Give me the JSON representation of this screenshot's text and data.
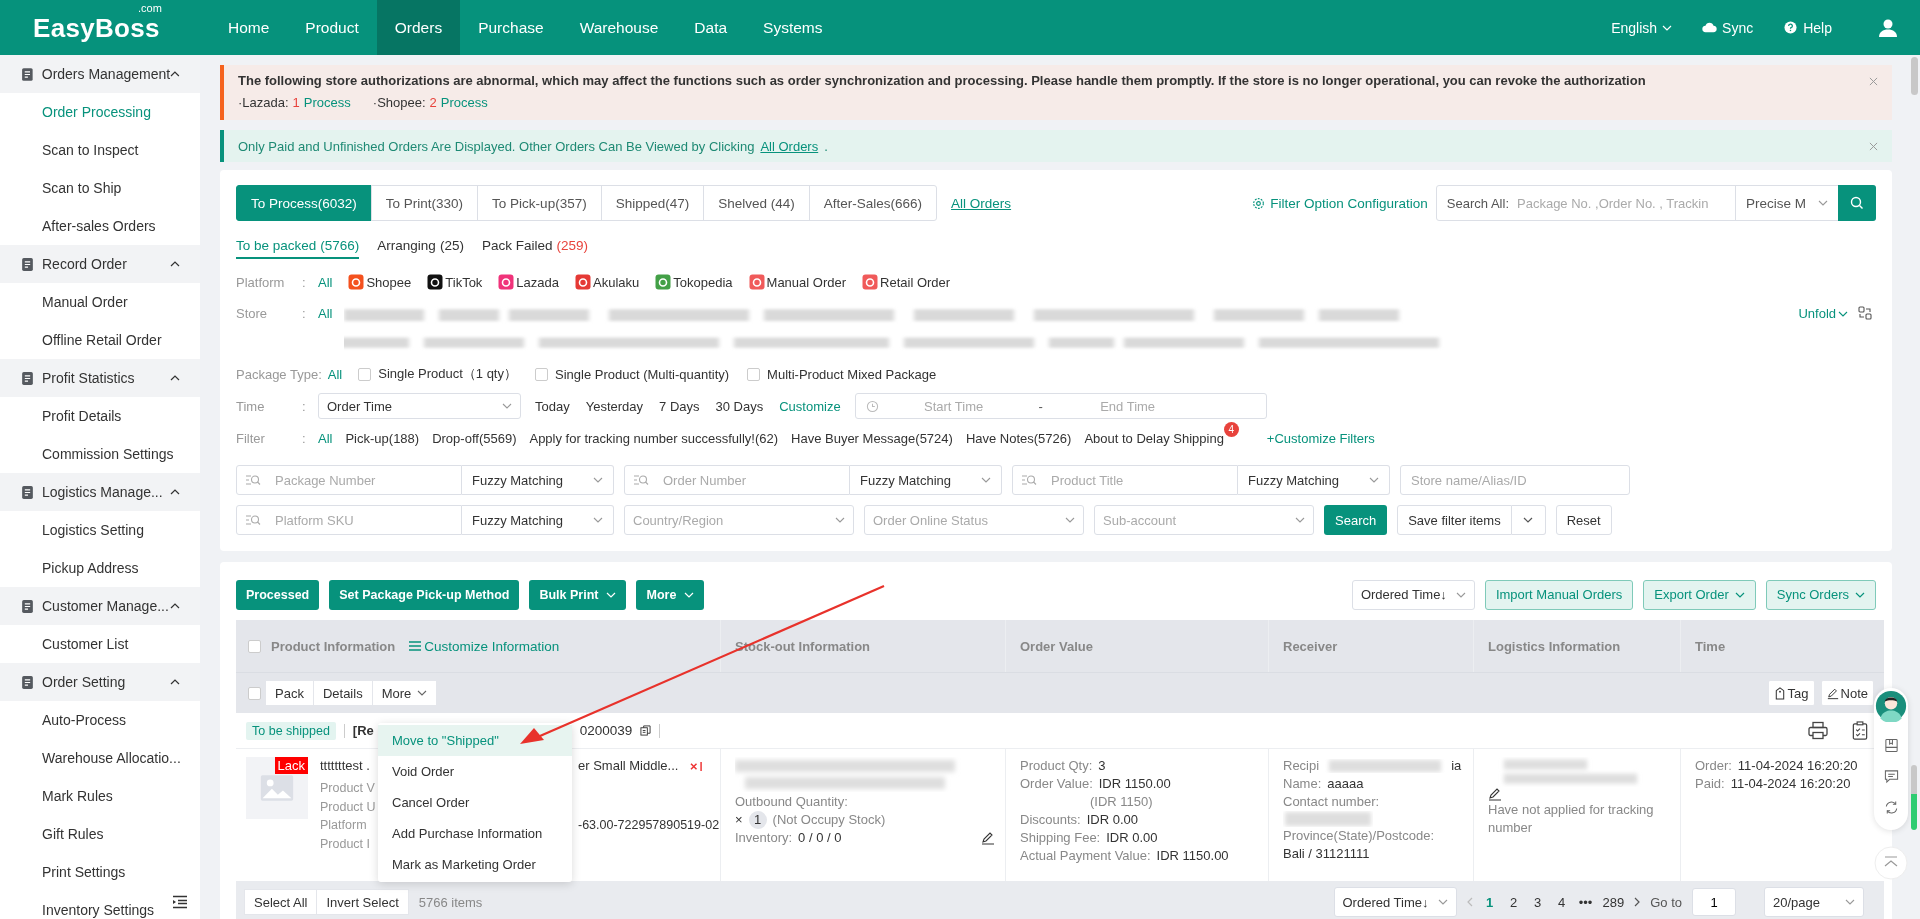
{
  "header": {
    "logo": "EasyBoss",
    "logo_suffix": ".com",
    "nav": [
      {
        "label": "Home",
        "selected": false
      },
      {
        "label": "Product",
        "selected": false
      },
      {
        "label": "Orders",
        "selected": true
      },
      {
        "label": "Purchase",
        "selected": false
      },
      {
        "label": "Warehouse",
        "selected": false
      },
      {
        "label": "Data",
        "selected": false
      },
      {
        "label": "Systems",
        "selected": false
      }
    ],
    "language": "English",
    "sync": "Sync",
    "help": "Help"
  },
  "sidebar": [
    {
      "title": "Orders Management",
      "expanded": true,
      "items": [
        {
          "label": "Order Processing",
          "selected": true
        },
        {
          "label": "Scan to Inspect",
          "selected": false
        },
        {
          "label": "Scan to Ship",
          "selected": false
        },
        {
          "label": "After-sales Orders",
          "selected": false
        }
      ]
    },
    {
      "title": "Record Order",
      "expanded": true,
      "items": [
        {
          "label": "Manual Order",
          "selected": false
        },
        {
          "label": "Offline Retail Order",
          "selected": false
        }
      ]
    },
    {
      "title": "Profit Statistics",
      "expanded": true,
      "items": [
        {
          "label": "Profit Details",
          "selected": false
        },
        {
          "label": "Commission Settings",
          "selected": false
        }
      ]
    },
    {
      "title": "Logistics Manage...",
      "expanded": true,
      "items": [
        {
          "label": "Logistics Setting",
          "selected": false
        },
        {
          "label": "Pickup Address",
          "selected": false
        }
      ]
    },
    {
      "title": "Customer Manage...",
      "expanded": true,
      "items": [
        {
          "label": "Customer List",
          "selected": false
        }
      ]
    },
    {
      "title": "Order Setting",
      "expanded": true,
      "items": [
        {
          "label": "Auto-Process",
          "selected": false
        },
        {
          "label": "Warehouse Allocatio...",
          "selected": false
        },
        {
          "label": "Mark Rules",
          "selected": false
        },
        {
          "label": "Gift Rules",
          "selected": false
        },
        {
          "label": "Print Settings",
          "selected": false
        },
        {
          "label": "Inventory Settings",
          "selected": false
        }
      ]
    }
  ],
  "alerts": {
    "warning": {
      "text": "The following store authorizations are abnormal, which may affect the functions such as order synchronization and processing. Please handle them promptly. If the store is no longer operational, you can revoke the authorization",
      "stores": [
        {
          "platform": "·Lazada:",
          "count": "1",
          "action": "Process"
        },
        {
          "platform": "·Shopee:",
          "count": "2",
          "action": "Process"
        }
      ]
    },
    "info": {
      "text": "Only Paid and Unfinished Orders Are Displayed. Other Orders Can Be Viewed by Clicking",
      "link": "All Orders",
      "end": "."
    }
  },
  "status_tabs": [
    {
      "label": "To Process(6032)",
      "selected": true
    },
    {
      "label": "To Print(330)",
      "selected": false
    },
    {
      "label": "To Pick-up(357)",
      "selected": false
    },
    {
      "label": "Shipped(47)",
      "selected": false
    },
    {
      "label": "Shelved (44)",
      "selected": false
    },
    {
      "label": "After-Sales(666)",
      "selected": false
    }
  ],
  "all_orders_link": "All Orders",
  "filter_config": "Filter Option Configuration",
  "search": {
    "label": "Search All:",
    "placeholder": "Package No. ,Order No. , Trackin",
    "mode": "Precise M"
  },
  "sub_tabs": [
    {
      "label": "To be packed",
      "count": "(5766)",
      "selected": true,
      "warning": false
    },
    {
      "label": "Arranging",
      "count": "(25)",
      "selected": false,
      "warning": false
    },
    {
      "label": "Pack Failed",
      "count": "(259)",
      "selected": false,
      "warning": true
    }
  ],
  "filters": {
    "platform": {
      "label": "Platform",
      "sep": ":",
      "options": [
        {
          "label": "All",
          "selected": true
        },
        {
          "label": "Shopee",
          "selected": false
        },
        {
          "label": "TikTok",
          "selected": false
        },
        {
          "label": "Lazada",
          "selected": false
        },
        {
          "label": "Akulaku",
          "selected": false
        },
        {
          "label": "Tokopedia",
          "selected": false
        },
        {
          "label": "Manual Order",
          "selected": false
        },
        {
          "label": "Retail Order",
          "selected": false
        }
      ]
    },
    "store": {
      "label": "Store",
      "sep": ":",
      "all": "All",
      "unfold": "Unfold"
    },
    "package_type": {
      "label": "Package Type",
      "sep": ":",
      "all": "All",
      "options": [
        {
          "label": "Single Product（1 qty）",
          "checked": false
        },
        {
          "label": "Single Product (Multi-quantity)",
          "checked": false
        },
        {
          "label": "Multi-Product Mixed Package",
          "checked": false
        }
      ]
    },
    "time": {
      "label": "Time",
      "sep": ":",
      "field": "Order Time",
      "presets": [
        "Today",
        "Yesterday",
        "7 Days",
        "30 Days"
      ],
      "customize": "Customize",
      "start_placeholder": "Start Time",
      "to": "-",
      "end_placeholder": "End Time"
    },
    "filter": {
      "label": "Filter",
      "sep": ":",
      "options": [
        {
          "label": "All",
          "selected": true
        },
        {
          "label": "Pick-up(188)",
          "selected": false
        },
        {
          "label": "Drop-off(5569)",
          "selected": false
        },
        {
          "label": "Apply for tracking number successfully!(62)",
          "selected": false
        },
        {
          "label": "Have Buyer Message(5724)",
          "selected": false
        },
        {
          "label": "Have Notes(5726)",
          "selected": false
        },
        {
          "label": "About to Delay Shipping",
          "selected": false,
          "badge": "4"
        }
      ],
      "customize": "+Customize Filters"
    }
  },
  "search_fields": [
    {
      "kind": "text",
      "placeholder": "Package Number",
      "match": "Fuzzy Matching"
    },
    {
      "kind": "text",
      "placeholder": "Order Number",
      "match": "Fuzzy Matching"
    },
    {
      "kind": "text",
      "placeholder": "Product Title",
      "match": "Fuzzy Matching"
    },
    {
      "kind": "plain",
      "placeholder": "Store name/Alias/ID"
    },
    {
      "kind": "text",
      "placeholder": "Platform SKU",
      "match": "Fuzzy Matching"
    },
    {
      "kind": "select",
      "placeholder": "Country/Region"
    },
    {
      "kind": "select",
      "placeholder": "Order Online Status"
    },
    {
      "kind": "select",
      "placeholder": "Sub-account"
    }
  ],
  "search_actions": {
    "search": "Search",
    "save": "Save filter items",
    "reset": "Reset"
  },
  "toolbar": {
    "actions": [
      {
        "label": "Processed",
        "menu": false
      },
      {
        "label": "Set Package Pick-up Method",
        "menu": false
      },
      {
        "label": "Bulk Print",
        "menu": true
      },
      {
        "label": "More",
        "menu": true
      }
    ],
    "sort": "Ordered Time↓",
    "right": [
      {
        "label": "Import Manual Orders",
        "menu": false
      },
      {
        "label": "Export Order",
        "menu": true
      },
      {
        "label": "Sync Orders",
        "menu": true
      }
    ]
  },
  "table": {
    "select_all_checked": false,
    "columns": [
      "Product Information",
      "Stock-out Information",
      "Order Value",
      "Receiver",
      "Logistics Information",
      "Time"
    ],
    "customize": "Customize Information",
    "package": {
      "checked": false,
      "actions": [
        {
          "label": "Pack",
          "menu": false
        },
        {
          "label": "Details",
          "menu": false
        },
        {
          "label": "More",
          "menu": true
        }
      ],
      "tag": "Tag",
      "note": "Note",
      "status": "To be shipped",
      "number_start": "[Re",
      "number_end": "0200039",
      "menu": [
        {
          "label": "Move to \"Shipped\"",
          "selected": true
        },
        {
          "label": "Void Order",
          "selected": false
        },
        {
          "label": "Cancel Order",
          "selected": false
        },
        {
          "label": "Add Purchase Information",
          "selected": false
        },
        {
          "label": "Mark as Marketing Order",
          "selected": false
        }
      ],
      "product": {
        "badge": "Lack",
        "name_start": "tttttttest .",
        "name_end": "er Small Middle...",
        "fields": [
          "Product V",
          "Product U",
          "Platform",
          "Product I"
        ],
        "sku_end": "-63.00-722957890519-02"
      },
      "stock": {
        "outbound_label": "Outbound Quantity:",
        "times": "×",
        "qty": "1",
        "note": "(Not Occupy Stock)",
        "inventory_label": "Inventory:",
        "inventory": "0 / 0 / 0"
      },
      "value": [
        {
          "label": "Product Qty:",
          "value": "3"
        },
        {
          "label": "Order Value:",
          "value": "IDR 1150.00",
          "sub": "(IDR 1150)"
        },
        {
          "label": "Discounts:",
          "value": "IDR 0.00"
        },
        {
          "label": "Shipping Fee:",
          "value": "IDR 0.00"
        },
        {
          "label": "Actual Payment Value:",
          "value": "IDR 1150.00"
        }
      ],
      "receiver": {
        "recipient_start": "Recipi",
        "recipient_end": "ia",
        "name_label": "Name:",
        "name": "aaaaa",
        "contact_label": "Contact number:",
        "province_label": "Province(State)/Postcode:",
        "province": "Bali / 31121111"
      },
      "logistics": {
        "tracking_note": "Have not applied for tracking number"
      },
      "time": [
        {
          "label": "Order:",
          "value": "11-04-2024 16:20:20"
        },
        {
          "label": "Paid:",
          "value": "11-04-2024 16:20:20"
        }
      ]
    }
  },
  "footer": {
    "select_all": "Select All",
    "invert": "Invert Select",
    "count": "5766 items",
    "sort": "Ordered Time↓",
    "pages": [
      {
        "label": "1",
        "selected": true
      },
      {
        "label": "2",
        "selected": false
      },
      {
        "label": "3",
        "selected": false
      },
      {
        "label": "4",
        "selected": false
      },
      {
        "label": "•••",
        "selected": false
      },
      {
        "label": "289",
        "selected": false
      }
    ],
    "goto": "Go to",
    "goto_value": "1",
    "page_size": "20/page"
  }
}
